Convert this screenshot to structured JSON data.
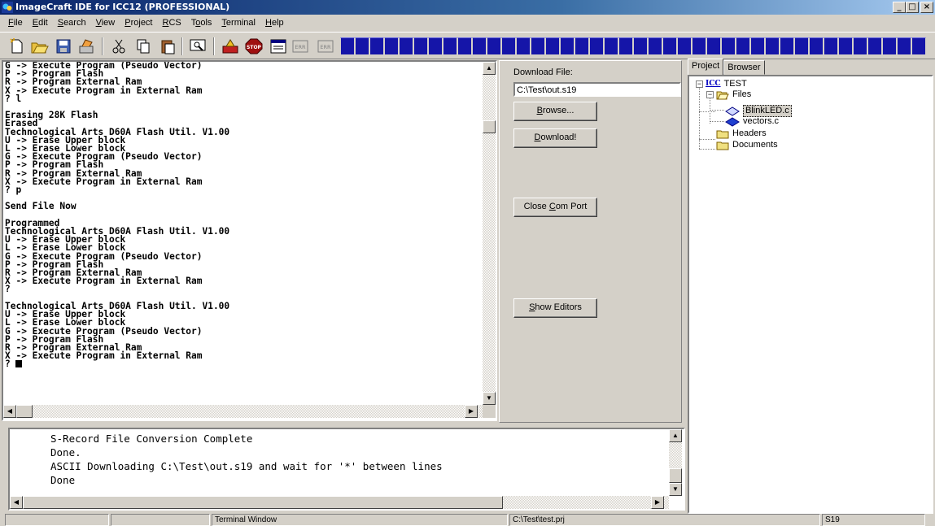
{
  "window": {
    "title": "ImageCraft IDE for ICC12 (PROFESSIONAL)",
    "min_glyph": "_",
    "max_glyph": "□",
    "close_glyph": "×"
  },
  "menu": [
    {
      "underline": "F",
      "rest": "ile"
    },
    {
      "underline": "E",
      "rest": "dit"
    },
    {
      "underline": "S",
      "rest": "earch"
    },
    {
      "underline": "V",
      "rest": "iew"
    },
    {
      "underline": "P",
      "rest": "roject"
    },
    {
      "underline": "R",
      "rest": "CS"
    },
    {
      "pre": "T",
      "underline": "o",
      "rest": "ols"
    },
    {
      "underline": "T",
      "rest": "erminal"
    },
    {
      "underline": "H",
      "rest": "elp"
    }
  ],
  "toolbar": {
    "stop_label": "STOP",
    "err_label_1": "ERR",
    "err_label_2": "ERR",
    "icons": [
      "new-file-icon",
      "open-folder-icon",
      "save-icon",
      "compile-icon",
      "cut-icon",
      "copy-icon",
      "paste-icon",
      "find-icon",
      "build-icon",
      "stop-icon",
      "project-options-icon",
      "error-prev-icon",
      "error-next-icon"
    ]
  },
  "terminal": {
    "lines": "G -> Execute Program (Pseudo Vector)\nP -> Program Flash\nR -> Program External Ram\nX -> Execute Program in External Ram\n? l\n\nErasing 28K Flash\nErased\nTechnological Arts D60A Flash Util. V1.00\nU -> Erase Upper block\nL -> Erase Lower block\nG -> Execute Program (Pseudo Vector)\nP -> Program Flash\nR -> Program External Ram\nX -> Execute Program in External Ram\n? p\n\nSend File Now\n\nProgrammed\nTechnological Arts D60A Flash Util. V1.00\nU -> Erase Upper block\nL -> Erase Lower block\nG -> Execute Program (Pseudo Vector)\nP -> Program Flash\nR -> Program External Ram\nX -> Execute Program in External Ram\n?\n\nTechnological Arts D60A Flash Util. V1.00\nU -> Erase Upper block\nL -> Erase Lower block\nG -> Execute Program (Pseudo Vector)\nP -> Program Flash\nR -> Program External Ram\nX -> Execute Program in External Ram\n? "
  },
  "panel": {
    "download_label": "Download File:",
    "download_path": "C:\\Test\\out.s19",
    "browse_u": "B",
    "browse_rest": "rowse...",
    "download_u": "D",
    "download_rest": "ownload!",
    "close_pre": "Close ",
    "close_u": "C",
    "close_rest": "om Port",
    "show_u": "S",
    "show_rest": "how Editors"
  },
  "output": {
    "lines": "S-Record File Conversion Complete\nDone.\nASCII Downloading C:\\Test\\out.s19 and wait for '*' between lines\nDone"
  },
  "project": {
    "tabs": [
      "Project",
      "Browser"
    ],
    "root": "TEST",
    "root_badge": "ICC",
    "files_folder": "Files",
    "files": [
      "BlinkLED.c",
      "vectors.c"
    ],
    "headers_folder": "Headers",
    "documents_folder": "Documents"
  },
  "status": {
    "cell1": "",
    "cell2": "",
    "window_name": "Terminal Window",
    "project_path": "C:\\Test\\test.prj",
    "mode": "S19"
  },
  "colors": {
    "title_start": "#0a246a",
    "title_end": "#a6caf0",
    "toolbar_block": "#1515a8",
    "face": "#d4d0c8"
  }
}
